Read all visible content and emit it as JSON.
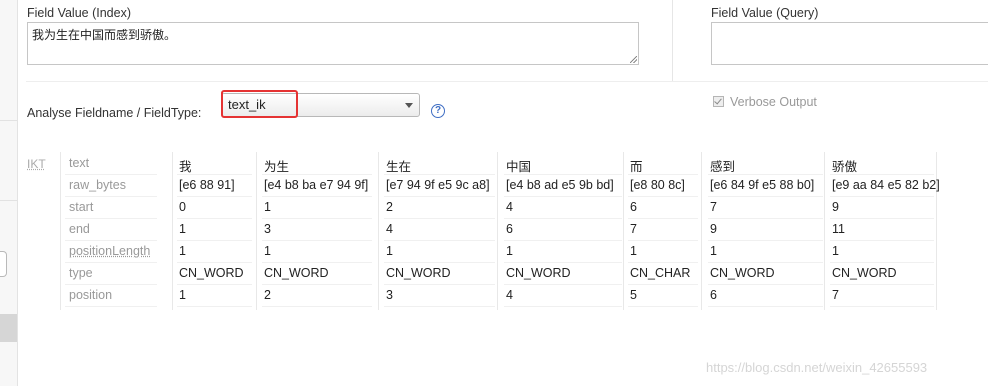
{
  "index_field": {
    "label": "Field Value (Index)",
    "value": "我为生在中国而感到骄傲。"
  },
  "query_field": {
    "label": "Field Value (Query)",
    "value": ""
  },
  "analyse": {
    "label": "Analyse Fieldname / FieldType:",
    "selected": "text_ik",
    "help_glyph": "?"
  },
  "verbose": {
    "label": "Verbose Output",
    "checked": true
  },
  "analysis": {
    "analyzer": "IKT",
    "row_labels": [
      "text",
      "raw_bytes",
      "start",
      "end",
      "positionLength",
      "type",
      "position"
    ],
    "tokens": [
      {
        "text": "我",
        "raw_bytes": "[e6 88 91]",
        "start": "0",
        "end": "1",
        "positionLength": "1",
        "type": "CN_WORD",
        "position": "1"
      },
      {
        "text": "为生",
        "raw_bytes": "[e4 b8 ba e7 94 9f]",
        "start": "1",
        "end": "3",
        "positionLength": "1",
        "type": "CN_WORD",
        "position": "2"
      },
      {
        "text": "生在",
        "raw_bytes": "[e7 94 9f e5 9c a8]",
        "start": "2",
        "end": "4",
        "positionLength": "1",
        "type": "CN_WORD",
        "position": "3"
      },
      {
        "text": "中国",
        "raw_bytes": "[e4 b8 ad e5 9b bd]",
        "start": "4",
        "end": "6",
        "positionLength": "1",
        "type": "CN_WORD",
        "position": "4"
      },
      {
        "text": "而",
        "raw_bytes": "[e8 80 8c]",
        "start": "6",
        "end": "7",
        "positionLength": "1",
        "type": "CN_CHAR",
        "position": "5"
      },
      {
        "text": "感到",
        "raw_bytes": "[e6 84 9f e5 88 b0]",
        "start": "7",
        "end": "9",
        "positionLength": "1",
        "type": "CN_WORD",
        "position": "6"
      },
      {
        "text": "骄傲",
        "raw_bytes": "[e9 aa 84 e5 82 b2]",
        "start": "9",
        "end": "11",
        "positionLength": "1",
        "type": "CN_WORD",
        "position": "7"
      }
    ]
  },
  "watermark": "https://blog.csdn.net/weixin_42655593",
  "colors": {
    "highlight": "#e53333",
    "help_icon": "#3f6ec4"
  }
}
